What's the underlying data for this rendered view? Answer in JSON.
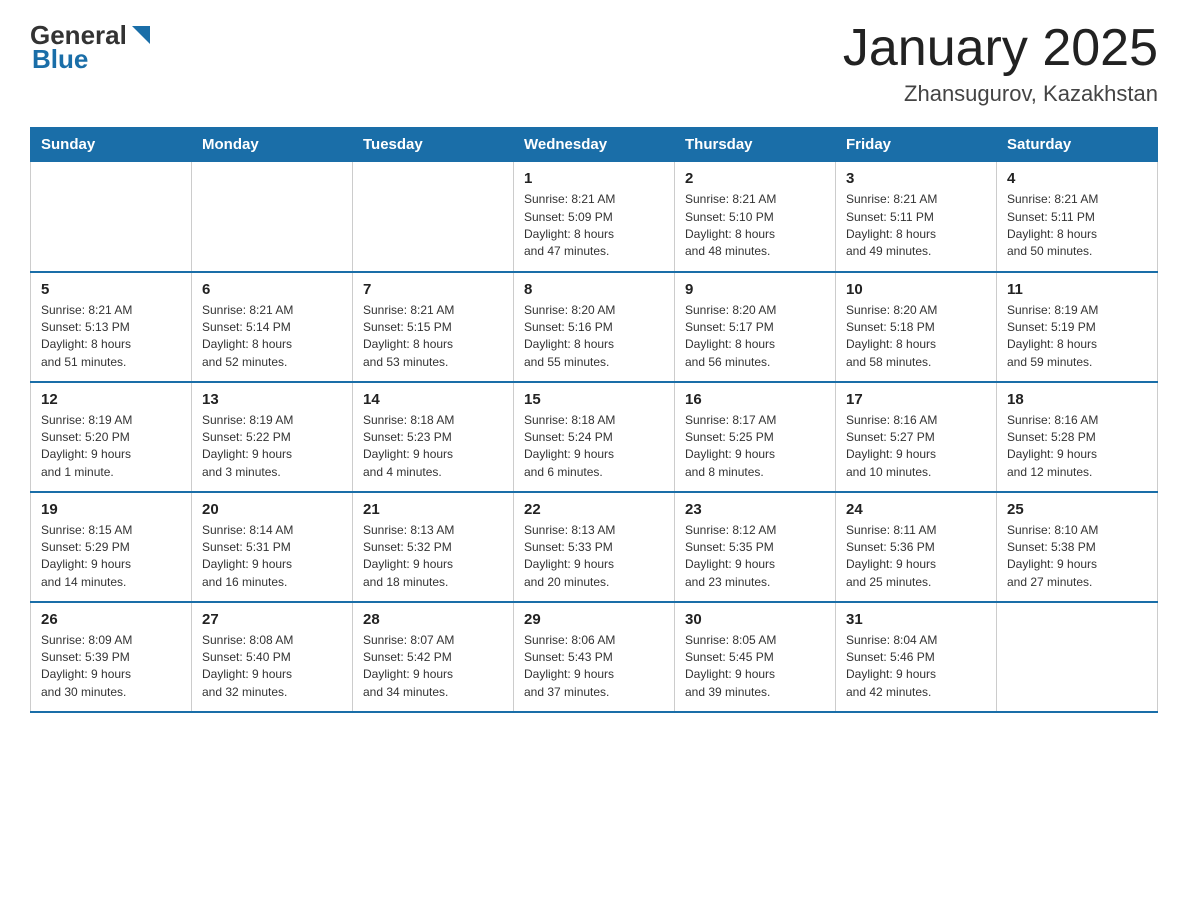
{
  "logo": {
    "general": "General",
    "blue": "Blue"
  },
  "title": "January 2025",
  "subtitle": "Zhansugurov, Kazakhstan",
  "headers": [
    "Sunday",
    "Monday",
    "Tuesday",
    "Wednesday",
    "Thursday",
    "Friday",
    "Saturday"
  ],
  "weeks": [
    [
      {
        "day": "",
        "info": ""
      },
      {
        "day": "",
        "info": ""
      },
      {
        "day": "",
        "info": ""
      },
      {
        "day": "1",
        "info": "Sunrise: 8:21 AM\nSunset: 5:09 PM\nDaylight: 8 hours\nand 47 minutes."
      },
      {
        "day": "2",
        "info": "Sunrise: 8:21 AM\nSunset: 5:10 PM\nDaylight: 8 hours\nand 48 minutes."
      },
      {
        "day": "3",
        "info": "Sunrise: 8:21 AM\nSunset: 5:11 PM\nDaylight: 8 hours\nand 49 minutes."
      },
      {
        "day": "4",
        "info": "Sunrise: 8:21 AM\nSunset: 5:11 PM\nDaylight: 8 hours\nand 50 minutes."
      }
    ],
    [
      {
        "day": "5",
        "info": "Sunrise: 8:21 AM\nSunset: 5:13 PM\nDaylight: 8 hours\nand 51 minutes."
      },
      {
        "day": "6",
        "info": "Sunrise: 8:21 AM\nSunset: 5:14 PM\nDaylight: 8 hours\nand 52 minutes."
      },
      {
        "day": "7",
        "info": "Sunrise: 8:21 AM\nSunset: 5:15 PM\nDaylight: 8 hours\nand 53 minutes."
      },
      {
        "day": "8",
        "info": "Sunrise: 8:20 AM\nSunset: 5:16 PM\nDaylight: 8 hours\nand 55 minutes."
      },
      {
        "day": "9",
        "info": "Sunrise: 8:20 AM\nSunset: 5:17 PM\nDaylight: 8 hours\nand 56 minutes."
      },
      {
        "day": "10",
        "info": "Sunrise: 8:20 AM\nSunset: 5:18 PM\nDaylight: 8 hours\nand 58 minutes."
      },
      {
        "day": "11",
        "info": "Sunrise: 8:19 AM\nSunset: 5:19 PM\nDaylight: 8 hours\nand 59 minutes."
      }
    ],
    [
      {
        "day": "12",
        "info": "Sunrise: 8:19 AM\nSunset: 5:20 PM\nDaylight: 9 hours\nand 1 minute."
      },
      {
        "day": "13",
        "info": "Sunrise: 8:19 AM\nSunset: 5:22 PM\nDaylight: 9 hours\nand 3 minutes."
      },
      {
        "day": "14",
        "info": "Sunrise: 8:18 AM\nSunset: 5:23 PM\nDaylight: 9 hours\nand 4 minutes."
      },
      {
        "day": "15",
        "info": "Sunrise: 8:18 AM\nSunset: 5:24 PM\nDaylight: 9 hours\nand 6 minutes."
      },
      {
        "day": "16",
        "info": "Sunrise: 8:17 AM\nSunset: 5:25 PM\nDaylight: 9 hours\nand 8 minutes."
      },
      {
        "day": "17",
        "info": "Sunrise: 8:16 AM\nSunset: 5:27 PM\nDaylight: 9 hours\nand 10 minutes."
      },
      {
        "day": "18",
        "info": "Sunrise: 8:16 AM\nSunset: 5:28 PM\nDaylight: 9 hours\nand 12 minutes."
      }
    ],
    [
      {
        "day": "19",
        "info": "Sunrise: 8:15 AM\nSunset: 5:29 PM\nDaylight: 9 hours\nand 14 minutes."
      },
      {
        "day": "20",
        "info": "Sunrise: 8:14 AM\nSunset: 5:31 PM\nDaylight: 9 hours\nand 16 minutes."
      },
      {
        "day": "21",
        "info": "Sunrise: 8:13 AM\nSunset: 5:32 PM\nDaylight: 9 hours\nand 18 minutes."
      },
      {
        "day": "22",
        "info": "Sunrise: 8:13 AM\nSunset: 5:33 PM\nDaylight: 9 hours\nand 20 minutes."
      },
      {
        "day": "23",
        "info": "Sunrise: 8:12 AM\nSunset: 5:35 PM\nDaylight: 9 hours\nand 23 minutes."
      },
      {
        "day": "24",
        "info": "Sunrise: 8:11 AM\nSunset: 5:36 PM\nDaylight: 9 hours\nand 25 minutes."
      },
      {
        "day": "25",
        "info": "Sunrise: 8:10 AM\nSunset: 5:38 PM\nDaylight: 9 hours\nand 27 minutes."
      }
    ],
    [
      {
        "day": "26",
        "info": "Sunrise: 8:09 AM\nSunset: 5:39 PM\nDaylight: 9 hours\nand 30 minutes."
      },
      {
        "day": "27",
        "info": "Sunrise: 8:08 AM\nSunset: 5:40 PM\nDaylight: 9 hours\nand 32 minutes."
      },
      {
        "day": "28",
        "info": "Sunrise: 8:07 AM\nSunset: 5:42 PM\nDaylight: 9 hours\nand 34 minutes."
      },
      {
        "day": "29",
        "info": "Sunrise: 8:06 AM\nSunset: 5:43 PM\nDaylight: 9 hours\nand 37 minutes."
      },
      {
        "day": "30",
        "info": "Sunrise: 8:05 AM\nSunset: 5:45 PM\nDaylight: 9 hours\nand 39 minutes."
      },
      {
        "day": "31",
        "info": "Sunrise: 8:04 AM\nSunset: 5:46 PM\nDaylight: 9 hours\nand 42 minutes."
      },
      {
        "day": "",
        "info": ""
      }
    ]
  ]
}
